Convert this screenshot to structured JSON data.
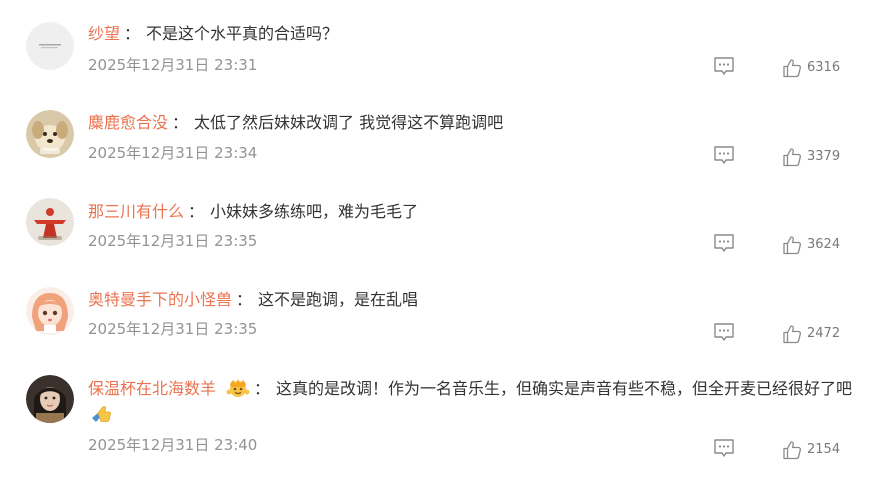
{
  "comments": [
    {
      "username": "纱望",
      "separator": "：",
      "text": "不是这个水平真的合适吗？",
      "time": "2025年12月31日 23:31",
      "likes": "6316",
      "avatar": "grey-placeholder-avatar"
    },
    {
      "username": "麋鹿愈合没",
      "separator": "：",
      "text": "太低了然后妹妹改调了 我觉得这不算跑调吧",
      "time": "2025年12月31日 23:34",
      "likes": "3379",
      "avatar": "dog-avatar"
    },
    {
      "username": "那三川有什么",
      "separator": "：",
      "text": "小妹妹多练练吧，难为毛毛了",
      "time": "2025年12月31日 23:35",
      "likes": "3624",
      "avatar": "red-figure-avatar"
    },
    {
      "username": "奥特曼手下的小怪兽",
      "separator": "：",
      "text": "这不是跑调，是在乱唱",
      "time": "2025年12月31日 23:35",
      "likes": "2472",
      "avatar": "anime-girl-avatar"
    },
    {
      "username": "保温杯在北海数羊",
      "separator": "：",
      "text": "这真的是改调！作为一名音乐生，但确实是声音有些不稳，但全开麦已经很好了吧",
      "time": "2025年12月31日 23:40",
      "likes": "2154",
      "avatar": "woman-photo-avatar",
      "badge": "crown-badge-icon",
      "trailing_emoji": "thumbs-up-emoji-icon"
    }
  ],
  "colors": {
    "username": "#eb7350",
    "text": "#333333",
    "time": "#939393",
    "icon": "#8a8a8a"
  }
}
